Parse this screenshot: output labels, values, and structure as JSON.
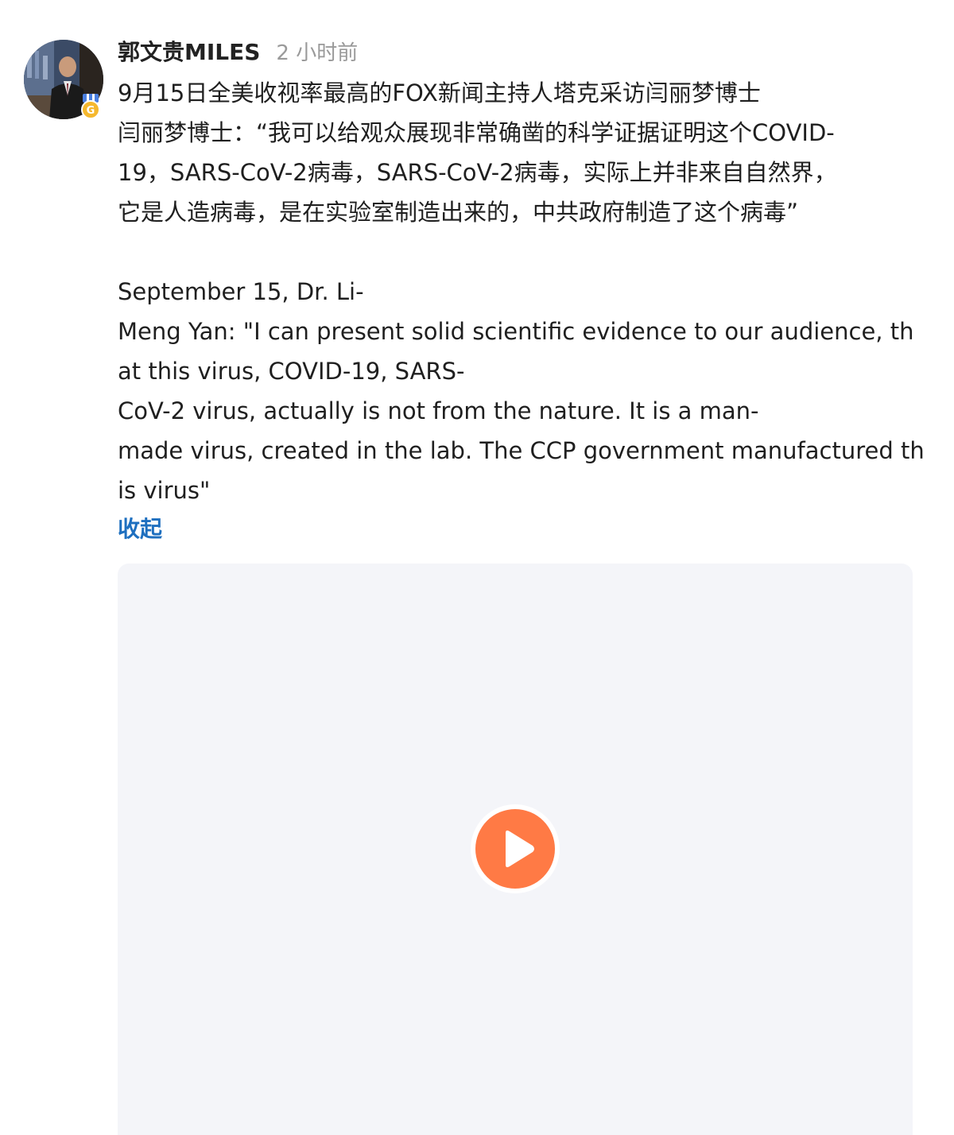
{
  "post": {
    "author": "郭文贵MILES",
    "time": "2 小时前",
    "avatar_icon": "user-avatar-photo",
    "badge_icon": "verified-medal-badge-icon",
    "badge_letter": "G",
    "lines": [
      "9月15日全美收视率最高的FOX新闻主持人塔克采访闫丽梦博士",
      "闫丽梦博士：“我可以给观众展现非常确凿的科学证据证明这个COVID-",
      "19，SARS-CoV-2病毒，SARS-CoV-2病毒，实际上并非来自自然界，",
      "它是人造病毒，是在实验室制造出来的，中共政府制造了这个病毒”",
      "",
      "September 15, Dr. Li-",
      "Meng Yan: \"I can present solid scientific evidence to our audience, th",
      "at this virus, COVID-19, SARS-",
      "CoV-2 virus, actually is not from the nature. It is a man-",
      "made virus, created in the lab. The CCP government manufactured th",
      "is virus\""
    ],
    "collapse_label": "收起",
    "video": {
      "play_icon": "play-icon"
    }
  },
  "colors": {
    "accent_link": "#1e6fbf",
    "play_button": "#ff7a45",
    "video_background": "#f4f5f9",
    "time_text": "#9a9a9a",
    "badge_blue": "#4a7fe0",
    "badge_gold": "#f5b82e"
  }
}
